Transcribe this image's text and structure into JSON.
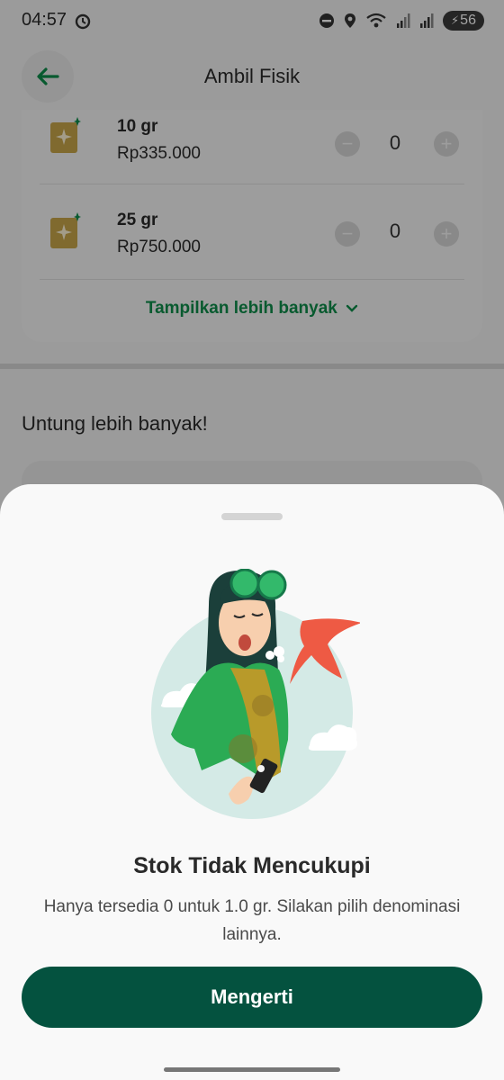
{
  "status_bar": {
    "time": "04:57",
    "battery": "56"
  },
  "header": {
    "title": "Ambil Fisik"
  },
  "products": [
    {
      "name": "10 gr",
      "price": "Rp335.000",
      "quantity": "0"
    },
    {
      "name": "25 gr",
      "price": "Rp750.000",
      "quantity": "0"
    }
  ],
  "show_more_label": "Tampilkan lebih banyak",
  "section": {
    "title": "Untung lebih banyak!"
  },
  "dialog": {
    "title": "Stok Tidak Mencukupi",
    "message": "Hanya tersedia 0 untuk 1.0 gr. Silakan pilih denominasi lainnya.",
    "button_label": "Mengerti"
  },
  "colors": {
    "accent_green": "#0e8d4a",
    "button_dark_green": "#04523f",
    "error_red": "#ee5a44"
  }
}
